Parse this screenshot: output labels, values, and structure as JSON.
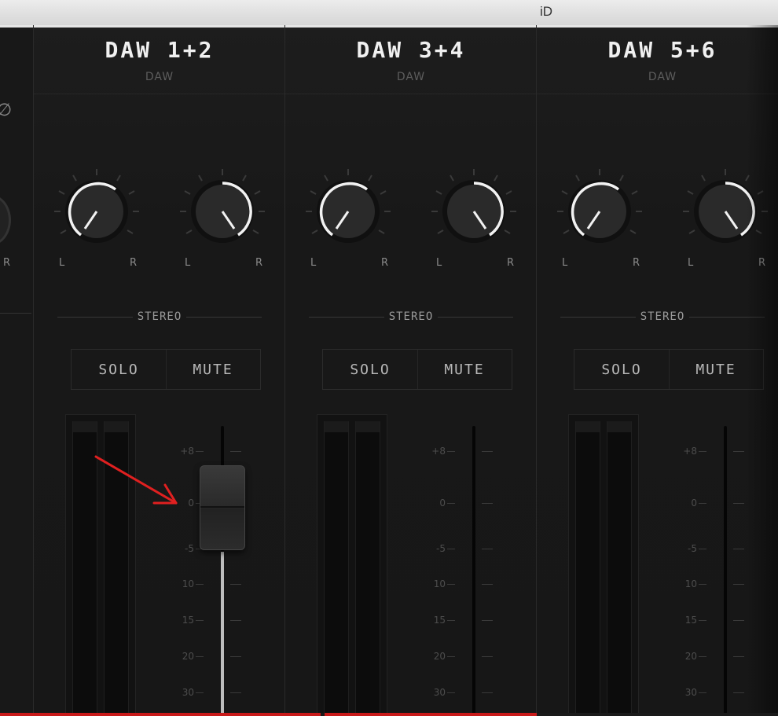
{
  "window": {
    "title": "iD"
  },
  "left_partial": {
    "phase_icon": "phase-invert-icon",
    "r_label": "R"
  },
  "strips": [
    {
      "name": "DAW 1+2",
      "type": "DAW",
      "knob_left": {
        "l_label": "L",
        "r_label": "R"
      },
      "knob_right": {
        "l_label": "L",
        "r_label": "R"
      },
      "stereo_label": "STEREO",
      "solo_label": "SOLO",
      "mute_label": "MUTE",
      "fader_visible": true
    },
    {
      "name": "DAW 3+4",
      "type": "DAW",
      "knob_left": {
        "l_label": "L",
        "r_label": "R"
      },
      "knob_right": {
        "l_label": "L",
        "r_label": "R"
      },
      "stereo_label": "STEREO",
      "solo_label": "SOLO",
      "mute_label": "MUTE",
      "fader_visible": false
    },
    {
      "name": "DAW 5+6",
      "type": "DAW",
      "knob_left": {
        "l_label": "L",
        "r_label": "R"
      },
      "knob_right": {
        "l_label": "L",
        "r_label": "R"
      },
      "stereo_label": "STEREO",
      "solo_label": "SOLO",
      "mute_label": "MUTE",
      "fader_visible": false
    }
  ],
  "fader_scale": [
    "+8",
    "0",
    "-5",
    "10",
    "15",
    "20",
    "30"
  ],
  "colors": {
    "accent": "#e6e6e6",
    "annotation_arrow": "#e02020",
    "progress": "#c81a1a"
  }
}
